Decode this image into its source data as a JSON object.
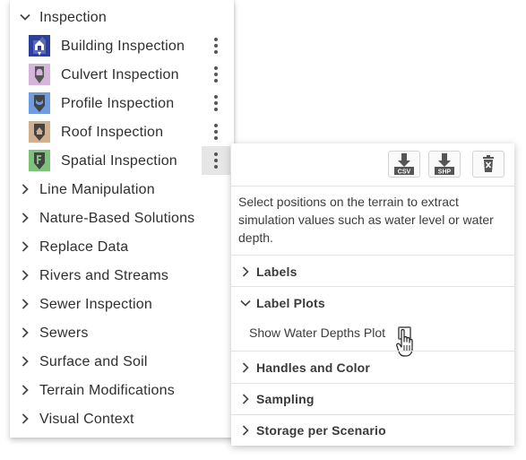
{
  "tree": {
    "inspection": {
      "label": "Inspection",
      "items": [
        {
          "label": "Building Inspection",
          "icon": "building-inspection-icon",
          "color": "#2d3f9e"
        },
        {
          "label": "Culvert Inspection",
          "icon": "culvert-inspection-icon",
          "color": "#d7b4dc"
        },
        {
          "label": "Profile Inspection",
          "icon": "profile-inspection-icon",
          "color": "#6f9be0"
        },
        {
          "label": "Roof Inspection",
          "icon": "roof-inspection-icon",
          "color": "#d2b08e"
        },
        {
          "label": "Spatial Inspection",
          "icon": "spatial-inspection-icon",
          "color": "#7dc47a"
        }
      ]
    },
    "categories": [
      "Line Manipulation",
      "Nature-Based Solutions",
      "Replace Data",
      "Rivers and Streams",
      "Sewer Inspection",
      "Sewers",
      "Surface and Soil",
      "Terrain Modifications",
      "Visual Context"
    ]
  },
  "popup": {
    "toolbar": {
      "csv_label": "CSV",
      "shp_label": "SHP"
    },
    "description": "Select positions on the terrain to extract simulation values such as water level or water depth.",
    "sections": {
      "labels": "Labels",
      "label_plots": "Label Plots",
      "show_water_depths_plot": "Show Water Depths Plot",
      "handles_and_color": "Handles and Color",
      "sampling": "Sampling",
      "storage_per_scenario": "Storage per Scenario"
    },
    "show_water_depths_checked": false
  }
}
